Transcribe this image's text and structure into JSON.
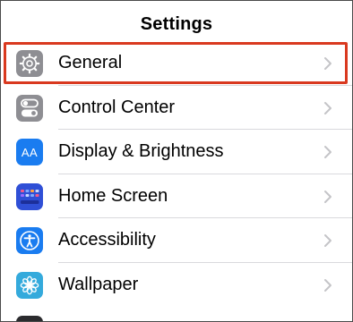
{
  "nav": {
    "title": "Settings"
  },
  "rows": [
    {
      "label": "General",
      "icon": "gear-icon",
      "icon_color": "#8e8e93"
    },
    {
      "label": "Control Center",
      "icon": "toggles-icon",
      "icon_color": "#8e8e93"
    },
    {
      "label": "Display & Brightness",
      "icon": "text-size-icon",
      "icon_color": "#1a7cf0",
      "icon_text": "AA"
    },
    {
      "label": "Home Screen",
      "icon": "home-grid-icon",
      "icon_color": "#2f4fd6"
    },
    {
      "label": "Accessibility",
      "icon": "accessibility-icon",
      "icon_color": "#1a7cf0"
    },
    {
      "label": "Wallpaper",
      "icon": "flower-icon",
      "icon_color": "#34aadc"
    }
  ],
  "highlight_color": "#d9391f"
}
